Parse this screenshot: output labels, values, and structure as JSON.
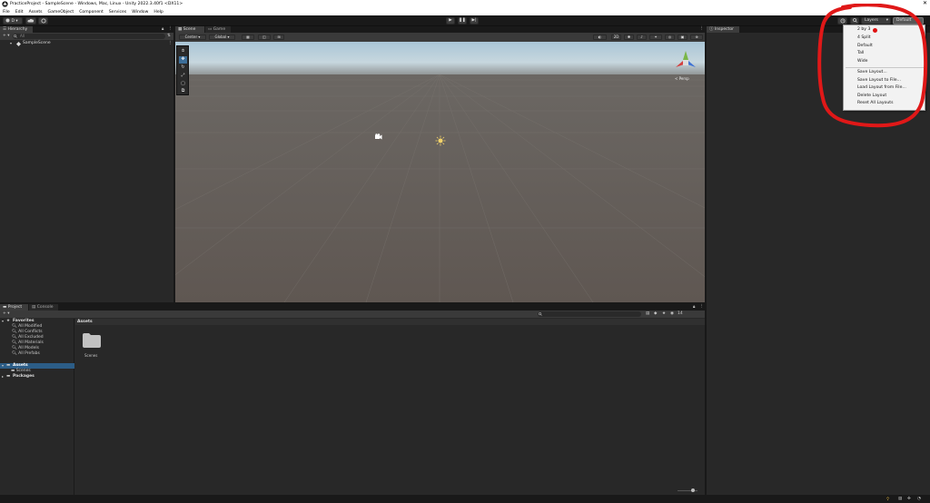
{
  "window": {
    "title": "PracticeProject - SampleScene - Windows, Mac, Linux - Unity 2022.3.40f1 <DX11>",
    "close_glyph": "✕"
  },
  "menu": [
    "File",
    "Edit",
    "Assets",
    "GameObject",
    "Component",
    "Services",
    "Window",
    "Help"
  ],
  "toolbar": {
    "account_label": "D ▾",
    "layers_label": "Layers",
    "layout_label": "Default",
    "play_glyph": "▶",
    "pause_glyph": "❚❚",
    "step_glyph": "▶|"
  },
  "hierarchy": {
    "tab": "Hierarchy",
    "add_label": "+ ▾",
    "search_placeholder": "All",
    "scene_name": "SampleScene"
  },
  "scene": {
    "tabs": [
      "Scene",
      "Game"
    ],
    "pivot_label": "Center",
    "space_label": "Global",
    "view_label": "< Persp"
  },
  "inspector": {
    "tab": "Inspector"
  },
  "layout_menu": {
    "items": [
      "2 by 3",
      "4 Split",
      "Default",
      "Tall",
      "Wide"
    ],
    "actions": [
      "Save Layout...",
      "Save Layout to File...",
      "Load Layout from File...",
      "Delete Layout",
      "Reset All Layouts"
    ],
    "current_marker_color": "#e01010"
  },
  "project": {
    "tabs": [
      "Project",
      "Console"
    ],
    "add_label": "+ ▾",
    "favorites_label": "Favorites",
    "favorites": [
      "All Modified",
      "All Conflicts",
      "All Excluded",
      "All Materials",
      "All Models",
      "All Prefabs"
    ],
    "assets_label": "Assets",
    "assets_children": [
      "Scenes"
    ],
    "packages_label": "Packages",
    "breadcrumb": "Assets",
    "folder_name": "Scenes",
    "hidden_count": "14"
  },
  "colors": {
    "annotation": "#e01818",
    "editor_bg": "#191919",
    "panel_bg": "#282828",
    "selection": "#2c5d87"
  }
}
